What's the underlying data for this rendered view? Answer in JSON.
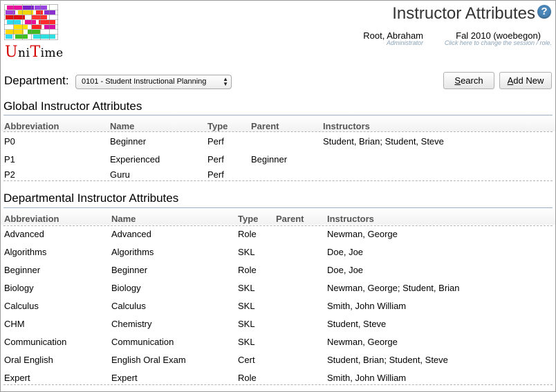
{
  "app": {
    "logo_text": "UniTime",
    "logo_letters": [
      "U",
      "ni",
      "T",
      "ime"
    ],
    "page_title": "Instructor Attributes",
    "help_icon": "help-icon"
  },
  "user": {
    "name": "Root, Abraham",
    "role": "Administrator"
  },
  "session": {
    "name": "Fal 2010 (woebegon)",
    "hint": "Click here to change the session / role."
  },
  "filter": {
    "label": "Department:",
    "selected": "0101 - Student Instructional Planning",
    "search_access_key": "S",
    "search_rest": "earch",
    "add_access_key": "A",
    "add_rest": "dd New"
  },
  "global": {
    "title": "Global Instructor Attributes",
    "columns": [
      "Abbreviation",
      "Name",
      "Type",
      "Parent",
      "Instructors"
    ],
    "rows": [
      [
        "P0",
        "Beginner",
        "Perf",
        "",
        "Student, Brian; Student, Steve"
      ],
      [
        "P1",
        "Experienced",
        "Perf",
        "Beginner",
        ""
      ],
      [
        "P2",
        "Guru",
        "Perf",
        "",
        ""
      ]
    ]
  },
  "departmental": {
    "title": "Departmental Instructor Attributes",
    "columns": [
      "Abbreviation",
      "Name",
      "Type",
      "Parent",
      "Instructors"
    ],
    "rows": [
      [
        "Advanced",
        "Advanced",
        "Role",
        "",
        "Newman, George"
      ],
      [
        "Algorithms",
        "Algorithms",
        "SKL",
        "",
        "Doe, Joe"
      ],
      [
        "Beginner",
        "Beginner",
        "Role",
        "",
        "Doe, Joe"
      ],
      [
        "Biology",
        "Biology",
        "SKL",
        "",
        "Newman, George; Student, Brian"
      ],
      [
        "Calculus",
        "Calculus",
        "SKL",
        "",
        "Smith, John William"
      ],
      [
        "CHM",
        "Chemistry",
        "SKL",
        "",
        "Student, Steve"
      ],
      [
        "Communication",
        "Communication",
        "SKL",
        "",
        "Newman, George"
      ],
      [
        "Oral English",
        "English Oral Exam",
        "Cert",
        "",
        "Student, Brian; Student, Steve"
      ],
      [
        "Expert",
        "Expert",
        "Role",
        "",
        "Smith, John William"
      ]
    ]
  },
  "colors": {
    "accent": "#4a86b8",
    "rule": "#9cb0c4",
    "logo_red": "#d40000",
    "hint": "#8aa2b8"
  }
}
